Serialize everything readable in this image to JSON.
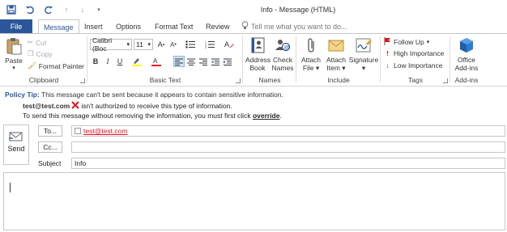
{
  "window": {
    "title": "Info - Message (HTML)"
  },
  "tabs": [
    {
      "label": "File"
    },
    {
      "label": "Message"
    },
    {
      "label": "Insert"
    },
    {
      "label": "Options"
    },
    {
      "label": "Format Text"
    },
    {
      "label": "Review"
    }
  ],
  "tell_me": {
    "placeholder": "Tell me what you want to do..."
  },
  "ribbon": {
    "clipboard": {
      "label": "Clipboard",
      "paste": "Paste",
      "cut": "Cut",
      "copy": "Copy",
      "format_painter": "Format Painter"
    },
    "basic_text": {
      "label": "Basic Text",
      "font": "Calibri (Boc",
      "size": "11"
    },
    "names": {
      "label": "Names",
      "address_book_1": "Address",
      "address_book_2": "Book",
      "check_names_1": "Check",
      "check_names_2": "Names"
    },
    "include": {
      "label": "Include",
      "attach_file_1": "Attach",
      "attach_file_2": "File",
      "attach_item_1": "Attach",
      "attach_item_2": "Item",
      "signature": "Signature"
    },
    "tags": {
      "label": "Tags",
      "follow_up": "Follow Up",
      "high_importance": "High Importance",
      "low_importance": "Low Importance"
    },
    "addins": {
      "office_1": "Office",
      "office_2": "Add-ins",
      "label": "Add-ins"
    }
  },
  "policy": {
    "label": "Policy Tip:",
    "message": "This message can't be sent because it appears to contain sensitive information.",
    "recipient": "test@test.com",
    "recipient_msg": "isn't authorized to receive this type of information.",
    "override_pre": "To send this message without removing the information, you must first click",
    "override_link": "override",
    "override_post": "."
  },
  "compose": {
    "send": "Send",
    "to_button": "To...",
    "cc_button": "Cc...",
    "subject_label": "Subject",
    "to_value": "test@test.com",
    "subject_value": "Info"
  },
  "colors": {
    "accent": "#2b579a",
    "error": "#e81123",
    "tip": "#2b579a"
  }
}
